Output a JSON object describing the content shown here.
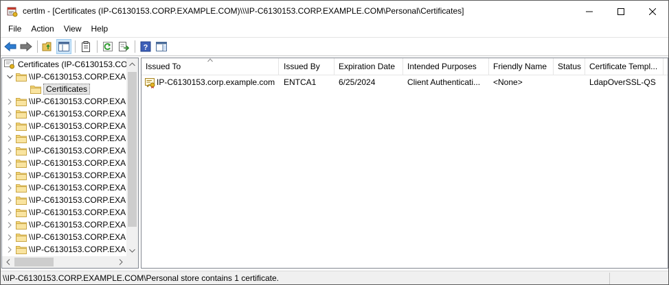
{
  "window": {
    "title": "certlm - [Certificates (IP-C6130153.CORP.EXAMPLE.COM)\\\\\\IP-C6130153.CORP.EXAMPLE.COM\\Personal\\Certificates]"
  },
  "menu": [
    "File",
    "Action",
    "View",
    "Help"
  ],
  "toolbar": {
    "icons": [
      "back-icon",
      "forward-icon",
      "up-folder-icon",
      "show-hide-tree-icon",
      "properties-icon",
      "refresh-icon",
      "export-list-icon",
      "help-icon",
      "action-pane-icon"
    ]
  },
  "tree": {
    "root": "Certificates (IP-C6130153.COF",
    "expanded": "\\\\IP-C6130153.CORP.EXAM",
    "selected": "Certificates",
    "items": [
      "\\\\IP-C6130153.CORP.EXAI",
      "\\\\IP-C6130153.CORP.EXAI",
      "\\\\IP-C6130153.CORP.EXAI",
      "\\\\IP-C6130153.CORP.EXAI",
      "\\\\IP-C6130153.CORP.EXAI",
      "\\\\IP-C6130153.CORP.EXAI",
      "\\\\IP-C6130153.CORP.EXAI",
      "\\\\IP-C6130153.CORP.EXAI",
      "\\\\IP-C6130153.CORP.EXAI",
      "\\\\IP-C6130153.CORP.EXAI",
      "\\\\IP-C6130153.CORP.EXAI",
      "\\\\IP-C6130153.CORP.EXAI",
      "\\\\IP-C6130153.CORP.EXAI"
    ]
  },
  "list": {
    "columns": [
      "Issued To",
      "Issued By",
      "Expiration Date",
      "Intended Purposes",
      "Friendly Name",
      "Status",
      "Certificate Templ..."
    ],
    "rows": [
      {
        "issued_to": "IP-C6130153.corp.example.com",
        "issued_by": "ENTCA1",
        "expiration": "6/25/2024",
        "purposes": "Client Authenticati...",
        "friendly_name": "<None>",
        "status": "",
        "template": "LdapOverSSL-QS"
      }
    ]
  },
  "status": {
    "text": "\\\\IP-C6130153.CORP.EXAMPLE.COM\\Personal store contains 1 certificate."
  },
  "colors": {
    "folder": "#f5d878",
    "selection": "#cce4f7",
    "scrollbar_thumb": "#cdcdcd"
  }
}
